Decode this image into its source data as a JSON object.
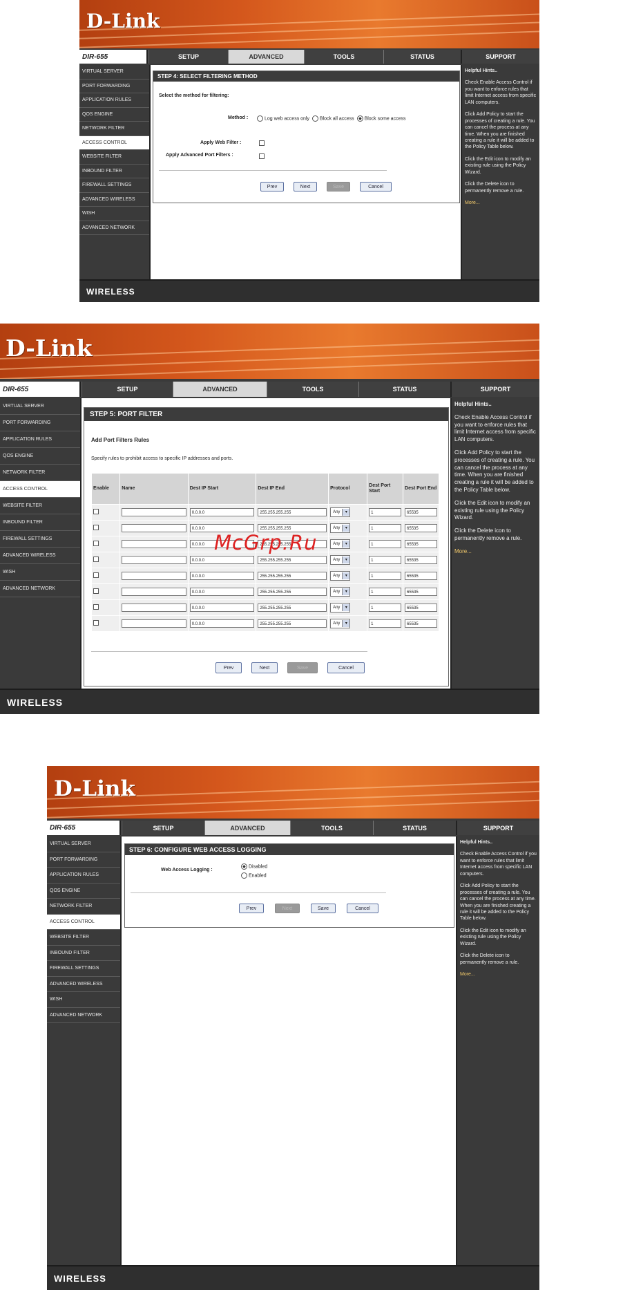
{
  "brand": "D-Link",
  "footer": "WIRELESS",
  "watermark": "McGrp.Ru",
  "nav": {
    "model": "DIR-655",
    "tabs": [
      "SETUP",
      "ADVANCED",
      "TOOLS",
      "STATUS"
    ],
    "support": "SUPPORT"
  },
  "sidebar": [
    "VIRTUAL SERVER",
    "PORT FORWARDING",
    "APPLICATION RULES",
    "QOS ENGINE",
    "NETWORK FILTER",
    "ACCESS CONTROL",
    "WEBSITE FILTER",
    "INBOUND FILTER",
    "FIREWALL SETTINGS",
    "ADVANCED WIRELESS",
    "WISH",
    "ADVANCED NETWORK"
  ],
  "help": {
    "heading": "Helpful Hints..",
    "p1": "Check Enable Access Control if you want to enforce rules that limit Internet access from specific LAN computers.",
    "p2": "Click Add Policy to start the processes of creating a rule. You can cancel the process at any time. When you are finished creating a rule it will be added to the Policy Table below.",
    "p3": "Click the Edit icon to modify an existing rule using the Policy Wizard.",
    "p4": "Click the Delete icon to permanently remove a rule.",
    "more": "More..."
  },
  "step4": {
    "title": "STEP 4: SELECT FILTERING METHOD",
    "instruction": "Select the method for filtering:",
    "method_label": "Method :",
    "methods": [
      "Log web access only",
      "Block all access",
      "Block some access"
    ],
    "web_filter_label": "Apply Web Filter :",
    "adv_port_label": "Apply Advanced Port Filters :",
    "buttons": [
      "Prev",
      "Next",
      "Save",
      "Cancel"
    ]
  },
  "step5": {
    "title": "STEP 5: PORT FILTER",
    "subtitle": "Add Port Filters Rules",
    "instruction": "Specify rules to prohibit access to specific IP addresses and ports.",
    "columns": [
      "Enable",
      "Name",
      "Dest IP Start",
      "Dest IP End",
      "Protocol",
      "Dest Port Start",
      "Dest Port End"
    ],
    "rows": [
      {
        "start": "0.0.0.0",
        "end": "255.255.255.255",
        "protocol": "Any",
        "port_start": "1",
        "port_end": "65535"
      },
      {
        "start": "0.0.0.0",
        "end": "255.255.255.255",
        "protocol": "Any",
        "port_start": "1",
        "port_end": "65535"
      },
      {
        "start": "0.0.0.0",
        "end": "255.255.255.255",
        "protocol": "Any",
        "port_start": "1",
        "port_end": "65535"
      },
      {
        "start": "0.0.0.0",
        "end": "255.255.255.255",
        "protocol": "Any",
        "port_start": "1",
        "port_end": "65535"
      },
      {
        "start": "0.0.0.0",
        "end": "255.255.255.255",
        "protocol": "Any",
        "port_start": "1",
        "port_end": "65535"
      },
      {
        "start": "0.0.0.0",
        "end": "255.255.255.255",
        "protocol": "Any",
        "port_start": "1",
        "port_end": "65535"
      },
      {
        "start": "0.0.0.0",
        "end": "255.255.255.255",
        "protocol": "Any",
        "port_start": "1",
        "port_end": "65535"
      },
      {
        "start": "0.0.0.0",
        "end": "255.255.255.255",
        "protocol": "Any",
        "port_start": "1",
        "port_end": "65535"
      }
    ],
    "buttons": [
      "Prev",
      "Next",
      "Save",
      "Cancel"
    ]
  },
  "step6": {
    "title": "STEP 6: CONFIGURE WEB ACCESS LOGGING",
    "label": "Web Access Logging :",
    "options": [
      "Disabled",
      "Enabled"
    ],
    "buttons": [
      "Prev",
      "Next",
      "Save",
      "Cancel"
    ]
  }
}
